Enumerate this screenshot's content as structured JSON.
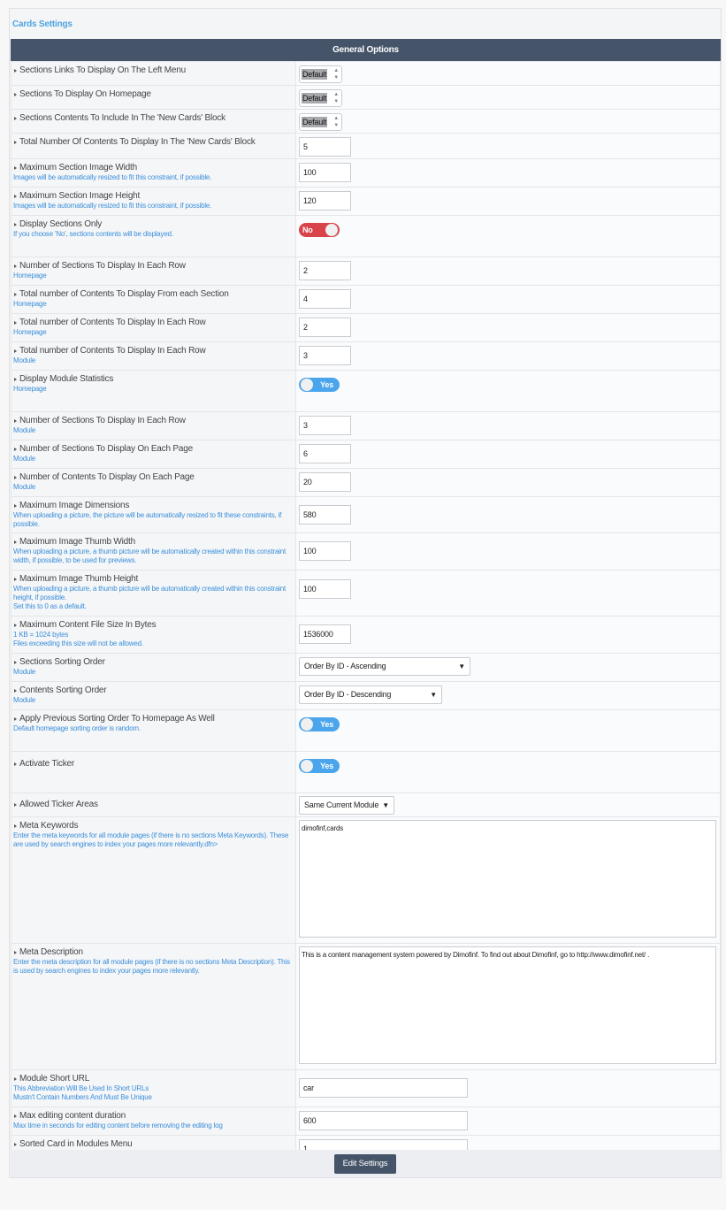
{
  "page_title": "Cards Settings",
  "section_header": "General Options",
  "rows": [
    {
      "label": "Sections Links To Display On The Left Menu",
      "desc": "",
      "control": "spinner",
      "value": "Default"
    },
    {
      "label": "Sections To Display On Homepage",
      "desc": "",
      "control": "spinner",
      "value": "Default"
    },
    {
      "label": "Sections Contents To Include In The 'New Cards' Block",
      "desc": "",
      "control": "spinner",
      "value": "Default"
    },
    {
      "label": "Total Number Of Contents To Display In The 'New Cards' Block",
      "desc": "",
      "control": "input",
      "value": "5"
    },
    {
      "label": "Maximum Section Image Width",
      "desc": "Images will be automatically resized to fit this constraint, if possible.",
      "control": "input",
      "value": "100"
    },
    {
      "label": "Maximum Section Image Height",
      "desc": "Images will be automatically resized to fit this constraint, if possible.",
      "control": "input",
      "value": "120"
    },
    {
      "label": "Display Sections Only",
      "desc": "If you choose 'No', sections contents will be displayed.",
      "control": "toggle",
      "value": "No"
    },
    {
      "label": "Number of Sections To Display In Each Row",
      "desc": "Homepage",
      "control": "input",
      "value": "2"
    },
    {
      "label": "Total number of Contents To Display From each Section",
      "desc": "Homepage",
      "control": "input",
      "value": "4"
    },
    {
      "label": "Total number of Contents To Display In Each Row",
      "desc": "Homepage",
      "control": "input",
      "value": "2"
    },
    {
      "label": "Total number of Contents To Display In Each Row",
      "desc": "Module",
      "control": "input",
      "value": "3"
    },
    {
      "label": "Display Module Statistics",
      "desc": "Homepage",
      "control": "toggle",
      "value": "Yes"
    },
    {
      "label": "Number of Sections To Display In Each Row",
      "desc": "Module",
      "control": "input",
      "value": "3"
    },
    {
      "label": "Number of Sections To Display On Each Page",
      "desc": "Module",
      "control": "input",
      "value": "6"
    },
    {
      "label": "Number of Contents To Display On Each Page",
      "desc": "Module",
      "control": "input",
      "value": "20"
    },
    {
      "label": "Maximum Image Dimensions",
      "desc": "When uploading a picture, the picture will be automatically resized to fit these constraints, if possible.",
      "control": "input",
      "value": "580"
    },
    {
      "label": "Maximum Image Thumb Width",
      "desc": "When uploading a picture, a thumb picture will be automatically created within this constraint width, if possible, to be used for previews.",
      "control": "input",
      "value": "100"
    },
    {
      "label": "Maximum Image Thumb Height",
      "desc": "When uploading a picture, a thumb picture will be automatically created within this constraint height, if possible.",
      "desc2": "Set this to 0 as a default.",
      "control": "input",
      "value": "100"
    },
    {
      "label": "Maximum Content File Size In Bytes",
      "desc": "1 KB = 1024 bytes",
      "desc2": "Files exceeding this size will not be allowed.",
      "control": "input",
      "value": "1536000"
    },
    {
      "label": "Sections Sorting Order",
      "desc": "Module",
      "control": "select",
      "value": "Order By ID - Ascending"
    },
    {
      "label": "Contents Sorting Order",
      "desc": "Module",
      "control": "select",
      "value": "Order By ID - Descending"
    },
    {
      "label": "Apply Previous Sorting Order To Homepage As Well",
      "desc": "Default homepage sorting order is random.",
      "control": "toggle",
      "value": "Yes"
    },
    {
      "label": "Activate Ticker",
      "desc": "",
      "control": "toggle",
      "value": "Yes"
    },
    {
      "label": "Allowed Ticker Areas",
      "desc": "",
      "control": "select",
      "value": "Same Current Module"
    },
    {
      "label": "Meta Keywords",
      "desc": "Enter the meta keywords for all module pages (if there is no sections Meta Keywords). These are used by search engines to index your pages more relevantly.dfn>",
      "control": "textarea",
      "value": "dimofinf,cards"
    },
    {
      "label": "Meta Description",
      "desc": "Enter the meta description for all module pages (if there is no sections Meta Description). This is used by search engines to index your pages more relevantly.",
      "control": "textarea",
      "value": "This is a content management system powered by Dimofinf. To find out about Dimofinf, go to http://www.dimofinf.net/ ."
    },
    {
      "label": "Module Short URL",
      "desc": "This Abbreviation Will Be Used In Short URLs",
      "desc2": "Mustn't Contain Numbers And Must Be Unique",
      "control": "input-wide",
      "value": "car"
    },
    {
      "label": "Max editing content duration",
      "desc": "Max time in seconds for editing content before removing the editing log",
      "control": "input-wide",
      "value": "600"
    },
    {
      "label": "Sorted Card in Modules Menu",
      "desc": "",
      "control": "input-wide",
      "value": "1"
    }
  ],
  "submit_label": "Edit Settings",
  "colors": {
    "header_bg": "#455469",
    "accent_blue": "#4fa3e0",
    "toggle_on": "#4aa5ec",
    "toggle_off": "#d9434a"
  }
}
